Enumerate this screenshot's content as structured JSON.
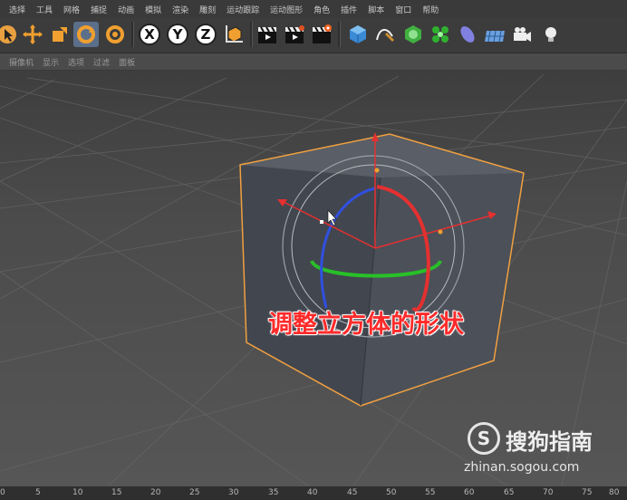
{
  "menu": {
    "items": [
      "选择",
      "工具",
      "网格",
      "捕捉",
      "动画",
      "模拟",
      "渲染",
      "雕刻",
      "运动跟踪",
      "运动图形",
      "角色",
      "插件",
      "脚本",
      "窗口",
      "帮助"
    ]
  },
  "toolbar": {
    "axis_x": "X",
    "axis_y": "Y",
    "axis_z": "Z"
  },
  "view_menu": {
    "items": [
      "摄像机",
      "显示",
      "选项",
      "过滤",
      "面板"
    ]
  },
  "caption": {
    "text": "调整立方体的形状"
  },
  "watermark": {
    "logo_letter": "S",
    "brand": "搜狗指南",
    "url": "zhinan.sogou.com"
  },
  "timeline": {
    "ticks": [
      "0",
      "5",
      "10",
      "15",
      "20",
      "25",
      "30",
      "35",
      "40",
      "45",
      "50",
      "55",
      "60",
      "65",
      "70",
      "75",
      "80"
    ]
  },
  "colors": {
    "x_axis": "#e53030",
    "y_axis": "#30c030",
    "z_axis": "#3050e0",
    "selection_outline": "#f0a040",
    "active_tool": "#5b6f8a"
  }
}
